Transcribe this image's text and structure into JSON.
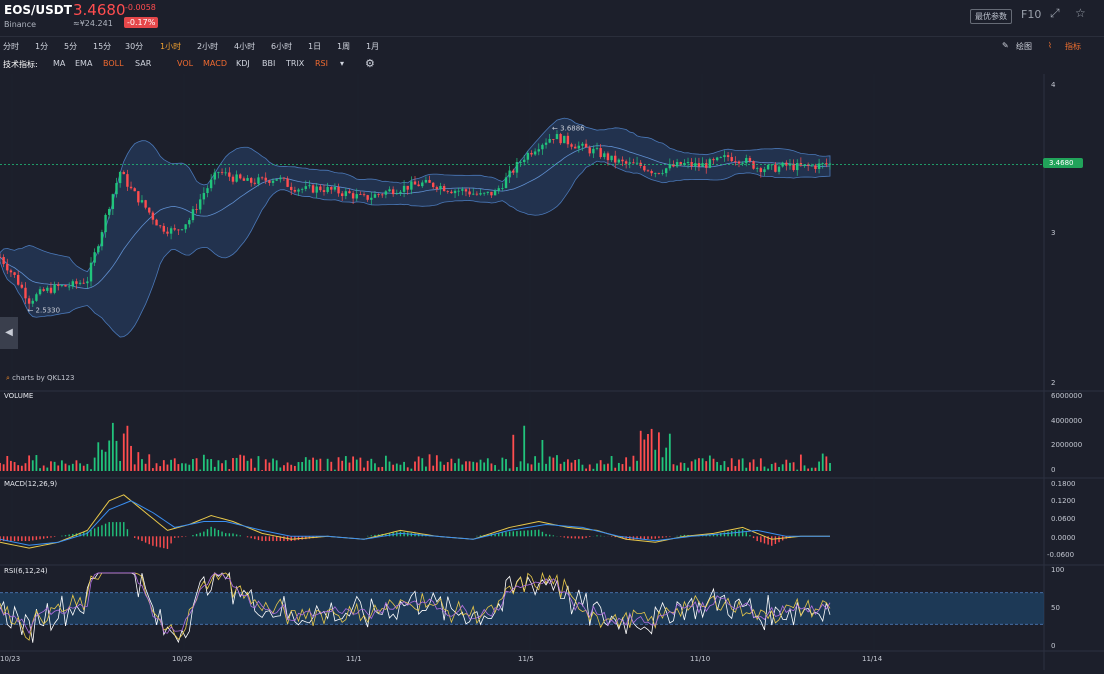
{
  "header": {
    "symbol": "EOS/USDT",
    "exchange": "Binance",
    "price": "3.4680",
    "cny_value": "≈¥24.241",
    "change": "-0.0058",
    "change_pct": "-0.17%",
    "settings_label": "最优参数",
    "f10_label": "F10",
    "colors": {
      "down": "#ff4d4f",
      "up": "#21c47c",
      "accent": "#f0a030"
    }
  },
  "timeframes": [
    "分时",
    "1分",
    "5分",
    "15分",
    "30分",
    "1小时",
    "2小时",
    "4小时",
    "6小时",
    "1日",
    "1周",
    "1月"
  ],
  "active_timeframe": "1小时",
  "draw_label": "绘图",
  "indicator_label": "指标",
  "indicators": {
    "label": "技术指标:",
    "main": [
      "MA",
      "EMA",
      "BOLL",
      "SAR"
    ],
    "sub": [
      "VOL",
      "MACD",
      "KDJ",
      "BBI",
      "TRIX",
      "RSI"
    ],
    "active": [
      "BOLL",
      "VOL",
      "MACD",
      "RSI"
    ]
  },
  "chart_data": [
    {
      "type": "candlestick",
      "panel": "price",
      "x_dates": [
        "10/23",
        "10/28",
        "11/1",
        "11/5",
        "11/10",
        "11/14"
      ],
      "price_axis_ticks": [
        2,
        3,
        4
      ],
      "ylim": [
        2,
        4
      ],
      "overlay": "BOLL",
      "current_price": 3.468,
      "annotations": [
        {
          "label": "3.6886",
          "value": 3.6886
        },
        {
          "label": "2.5330",
          "value": 2.533
        }
      ],
      "close_path": [
        [
          0,
          2.85
        ],
        [
          4,
          2.72
        ],
        [
          8,
          2.56
        ],
        [
          12,
          2.62
        ],
        [
          16,
          2.65
        ],
        [
          20,
          2.66
        ],
        [
          24,
          2.7
        ],
        [
          27,
          2.95
        ],
        [
          30,
          3.2
        ],
        [
          33,
          3.42
        ],
        [
          36,
          3.3
        ],
        [
          40,
          3.18
        ],
        [
          44,
          3.05
        ],
        [
          48,
          3.02
        ],
        [
          52,
          3.1
        ],
        [
          56,
          3.28
        ],
        [
          60,
          3.42
        ],
        [
          64,
          3.38
        ],
        [
          68,
          3.35
        ],
        [
          72,
          3.36
        ],
        [
          76,
          3.38
        ],
        [
          80,
          3.32
        ],
        [
          84,
          3.3
        ],
        [
          88,
          3.31
        ],
        [
          92,
          3.29
        ],
        [
          96,
          3.27
        ],
        [
          100,
          3.24
        ],
        [
          104,
          3.27
        ],
        [
          108,
          3.3
        ],
        [
          112,
          3.32
        ],
        [
          116,
          3.34
        ],
        [
          120,
          3.33
        ],
        [
          124,
          3.3
        ],
        [
          128,
          3.29
        ],
        [
          132,
          3.26
        ],
        [
          136,
          3.28
        ],
        [
          140,
          3.4
        ],
        [
          144,
          3.52
        ],
        [
          148,
          3.6
        ],
        [
          152,
          3.66
        ],
        [
          156,
          3.62
        ],
        [
          160,
          3.58
        ],
        [
          164,
          3.55
        ],
        [
          168,
          3.5
        ],
        [
          172,
          3.47
        ],
        [
          176,
          3.46
        ],
        [
          180,
          3.42
        ],
        [
          184,
          3.45
        ],
        [
          188,
          3.47
        ],
        [
          192,
          3.46
        ],
        [
          196,
          3.48
        ],
        [
          200,
          3.52
        ],
        [
          204,
          3.5
        ],
        [
          208,
          3.45
        ],
        [
          212,
          3.44
        ],
        [
          216,
          3.46
        ],
        [
          220,
          3.45
        ],
        [
          224,
          3.46
        ],
        [
          228,
          3.47
        ]
      ]
    },
    {
      "type": "bar",
      "panel": "volume",
      "title": "VOLUME",
      "axis_ticks": [
        0,
        2000000,
        4000000,
        6000000
      ],
      "tick_labels": [
        "0",
        "2000000",
        "4000000",
        "6000000"
      ],
      "ylim": [
        0,
        6000000
      ]
    },
    {
      "type": "line",
      "panel": "macd",
      "title": "MACD(12,26,9)",
      "axis_ticks": [
        -0.06,
        0,
        0.06,
        0.12,
        0.18
      ],
      "tick_labels": [
        "-0.0600",
        "0.0000",
        "0.0600",
        "0.1200",
        "0.1800"
      ],
      "ylim": [
        -0.08,
        0.18
      ],
      "dif_path": [
        [
          0,
          -0.02
        ],
        [
          8,
          -0.04
        ],
        [
          16,
          -0.02
        ],
        [
          24,
          0.02
        ],
        [
          30,
          0.12
        ],
        [
          34,
          0.14
        ],
        [
          40,
          0.08
        ],
        [
          46,
          0.02
        ],
        [
          52,
          0.04
        ],
        [
          58,
          0.07
        ],
        [
          64,
          0.05
        ],
        [
          72,
          0.01
        ],
        [
          80,
          -0.01
        ],
        [
          90,
          0.0
        ],
        [
          100,
          -0.01
        ],
        [
          110,
          0.02
        ],
        [
          120,
          0.0
        ],
        [
          130,
          -0.01
        ],
        [
          140,
          0.03
        ],
        [
          148,
          0.05
        ],
        [
          156,
          0.03
        ],
        [
          164,
          0.02
        ],
        [
          172,
          -0.01
        ],
        [
          180,
          -0.02
        ],
        [
          188,
          0.0
        ],
        [
          196,
          0.01
        ],
        [
          204,
          0.03
        ],
        [
          212,
          -0.01
        ],
        [
          220,
          0.0
        ],
        [
          228,
          0.0
        ]
      ],
      "dea_path": [
        [
          0,
          -0.01
        ],
        [
          8,
          -0.03
        ],
        [
          16,
          -0.02
        ],
        [
          24,
          0.01
        ],
        [
          30,
          0.09
        ],
        [
          36,
          0.12
        ],
        [
          42,
          0.08
        ],
        [
          48,
          0.03
        ],
        [
          56,
          0.05
        ],
        [
          62,
          0.05
        ],
        [
          72,
          0.02
        ],
        [
          80,
          0.0
        ],
        [
          90,
          0.0
        ],
        [
          100,
          -0.01
        ],
        [
          110,
          0.01
        ],
        [
          120,
          0.0
        ],
        [
          130,
          -0.01
        ],
        [
          140,
          0.02
        ],
        [
          150,
          0.04
        ],
        [
          160,
          0.03
        ],
        [
          170,
          0.0
        ],
        [
          180,
          -0.015
        ],
        [
          190,
          0.0
        ],
        [
          200,
          0.01
        ],
        [
          208,
          0.02
        ],
        [
          216,
          0.0
        ],
        [
          228,
          0.0
        ]
      ]
    },
    {
      "type": "line",
      "panel": "rsi",
      "title": "RSI(6,12,24)",
      "axis_ticks": [
        0,
        50,
        100
      ],
      "tick_labels": [
        "0",
        "50",
        "100"
      ],
      "ylim": [
        0,
        100
      ],
      "band": [
        30,
        70
      ]
    }
  ],
  "credit": {
    "prefix": "charts by",
    "name": "QKL123"
  }
}
